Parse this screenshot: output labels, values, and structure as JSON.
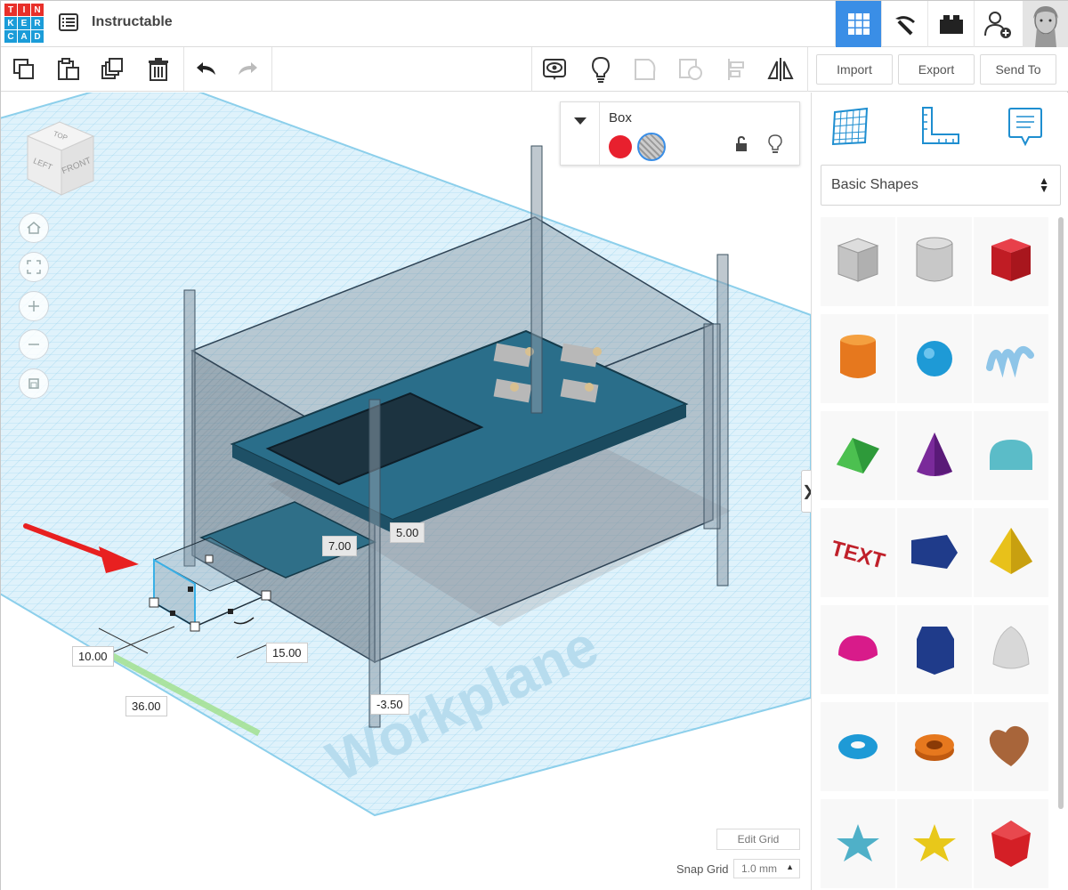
{
  "app": {
    "logo_letters": [
      "T",
      "I",
      "N",
      "K",
      "E",
      "R",
      "C",
      "A",
      "D"
    ],
    "logo_colors": [
      "#e8302a",
      "#e8302a",
      "#e8302a",
      "#1b9cd8",
      "#1b9cd8",
      "#1b9cd8",
      "#1b9cd8",
      "#1b9cd8",
      "#1b9cd8"
    ],
    "design_title": "Instructable",
    "accent_color": "#3a8ee6"
  },
  "header": {
    "buttons": [
      {
        "icon": "grid-view-icon",
        "active": true
      },
      {
        "icon": "pickaxe-icon",
        "active": false
      },
      {
        "icon": "bricks-icon",
        "active": false
      },
      {
        "icon": "add-user-icon",
        "active": false
      }
    ]
  },
  "toolbar": {
    "tools": [
      "copy-icon",
      "paste-icon",
      "duplicate-icon",
      "trash-icon",
      "undo-icon",
      "redo-icon"
    ],
    "view_tools": [
      "show-all-icon",
      "lightbulb-icon",
      "group-icon",
      "ungroup-icon",
      "align-icon",
      "mirror-icon"
    ],
    "import_label": "Import",
    "export_label": "Export",
    "send_to_label": "Send To"
  },
  "viewcube": {
    "top": "TOP",
    "left": "LEFT",
    "front": "FRONT"
  },
  "inspector": {
    "title": "Box",
    "solid_color": "#e8202e"
  },
  "dimensions": {
    "length": "10.00",
    "offset_x": "36.00",
    "width": "15.00",
    "height": "7.00",
    "elevation": "5.00",
    "z_offset": "-3.50"
  },
  "workplane": {
    "label": "Workplane",
    "edit_grid_label": "Edit Grid",
    "snap_grid_label": "Snap Grid",
    "snap_grid_value": "1.0 mm"
  },
  "panel": {
    "category": "Basic Shapes",
    "shapes": [
      {
        "name": "box-hole",
        "color": "#b8b8b8"
      },
      {
        "name": "cylinder-hole",
        "color": "#c8c8c8"
      },
      {
        "name": "box",
        "color": "#d41f26"
      },
      {
        "name": "cylinder",
        "color": "#e6781e"
      },
      {
        "name": "sphere",
        "color": "#1e9ad6"
      },
      {
        "name": "scribble",
        "color": "#8ec5e8"
      },
      {
        "name": "roof",
        "color": "#2e9a3a"
      },
      {
        "name": "cone",
        "color": "#7a2a9a"
      },
      {
        "name": "round-roof",
        "color": "#5bbcc8"
      },
      {
        "name": "text",
        "color": "#c0202a"
      },
      {
        "name": "wedge",
        "color": "#1f3b8a"
      },
      {
        "name": "pyramid",
        "color": "#e8c11a"
      },
      {
        "name": "half-sphere",
        "color": "#d81b8a"
      },
      {
        "name": "polygon",
        "color": "#1f3b8a"
      },
      {
        "name": "paraboloid",
        "color": "#d8d8d8"
      },
      {
        "name": "torus",
        "color": "#1e9ad6"
      },
      {
        "name": "tube",
        "color": "#e6781e"
      },
      {
        "name": "heart",
        "color": "#a8653a"
      },
      {
        "name": "star",
        "color": "#4fb0c8"
      },
      {
        "name": "star-gold",
        "color": "#e8c81a"
      },
      {
        "name": "icosahedron",
        "color": "#d41f26"
      }
    ]
  }
}
